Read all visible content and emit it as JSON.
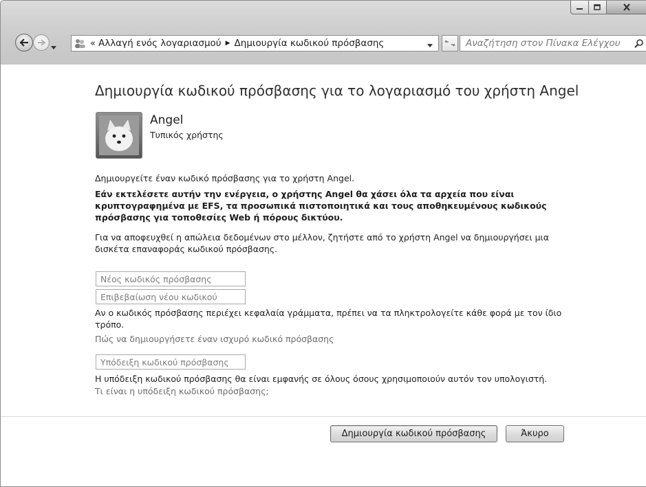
{
  "address_bar": {
    "overflow_chevron": "«",
    "breadcrumbs": [
      "Αλλαγή ενός λογαριασμού",
      "Δημιουργία κωδικού πρόσβασης"
    ],
    "search_placeholder": "Αναζήτηση στον Πίνακα Ελέγχου"
  },
  "main": {
    "title": "Δημιουργία κωδικού πρόσβασης για το λογαριασμό του χρήστη Angel",
    "user": {
      "name": "Angel",
      "account_type": "Τυπικός χρήστης"
    },
    "intro": "Δημιουργείτε έναν κωδικό πρόσβασης για το χρήστη Angel.",
    "warning": "Εάν εκτελέσετε αυτήν την ενέργεια, ο χρήστης Angel θα χάσει όλα τα αρχεία που είναι κρυπτογραφημένα με EFS, τα προσωπικά πιστοποιητικά και τους αποθηκευμένους κωδικούς πρόσβασης για τοποθεσίες Web ή πόρους δικτύου.",
    "advice": "Για να αποφευχθεί η απώλεια δεδομένων στο μέλλον, ζητήστε από το χρήστη Angel να δημιουργήσει μια δισκέτα επαναφοράς κωδικού πρόσβασης.",
    "new_password_placeholder": "Νέος κωδικός πρόσβασης",
    "confirm_password_placeholder": "Επιβεβαίωση νέου κωδικού",
    "case_note": "Αν ο κωδικός πρόσβασης περιέχει κεφαλαία γράμματα, πρέπει να τα πληκτρολογείτε κάθε φορά με τον ίδιο τρόπο.",
    "strong_password_link": "Πώς να δημιουργήσετε έναν ισχυρό κωδικό πρόσβασης",
    "hint_placeholder": "Υπόδειξη κωδικού πρόσβασης",
    "hint_note": "Η υπόδειξη κωδικού πρόσβασης θα είναι εμφανής σε όλους όσους χρησιμοποιούν αυτόν τον υπολογιστή.",
    "hint_link": "Τι είναι η υπόδειξη κωδικού πρόσβασης;"
  },
  "buttons": {
    "create": "Δημιουργία κωδικού πρόσβασης",
    "cancel": "Άκυρο"
  },
  "icons": [
    "minimize-icon",
    "maximize-icon",
    "close-icon",
    "back-arrow-icon",
    "forward-arrow-icon",
    "user-accounts-icon",
    "refresh-icon",
    "search-icon"
  ]
}
